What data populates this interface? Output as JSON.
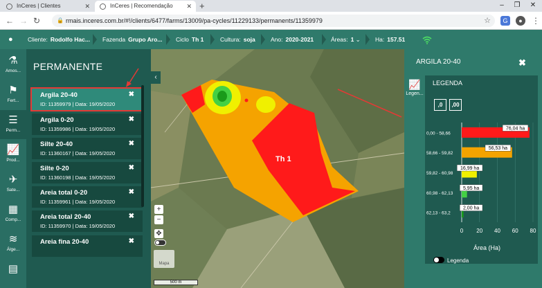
{
  "browser": {
    "tabs": [
      {
        "title": "InCeres | Clientes"
      },
      {
        "title": "InCeres | Recomendação"
      }
    ],
    "url": "rmais.inceres.com.br/#!/clients/6477/farms/13009/pa-cycles/11229133/permanents/11359979"
  },
  "header": {
    "client_label": "Cliente:",
    "client_value": "Rodolfo Hac...",
    "farm_label": "Fazenda",
    "farm_value": "Grupo Aro...",
    "cycle_label": "Ciclo",
    "cycle_value": "Th 1",
    "crop_label": "Cultura:",
    "crop_value": "soja",
    "year_label": "Ano:",
    "year_value": "2020-2021",
    "areas_label": "Áreas:",
    "areas_value": "1",
    "ha_label": "Ha:",
    "ha_value": "157.51"
  },
  "rail": [
    {
      "label": "Amos..."
    },
    {
      "label": "Fert..."
    },
    {
      "label": "Perm..."
    },
    {
      "label": "Prod..."
    },
    {
      "label": "Sate..."
    },
    {
      "label": "Comp..."
    },
    {
      "label": "Álge..."
    },
    {
      "label": ""
    }
  ],
  "panel": {
    "title": "PERMANENTE",
    "layers": [
      {
        "name": "Argila 20-40",
        "meta": "ID: 11359979 | Data: 19/05/2020"
      },
      {
        "name": "Argila 0-20",
        "meta": "ID: 11359986 | Data: 19/05/2020"
      },
      {
        "name": "Silte 20-40",
        "meta": "ID: 11360167 | Data: 19/05/2020"
      },
      {
        "name": "Silte 0-20",
        "meta": "ID: 11360198 | Data: 19/05/2020"
      },
      {
        "name": "Areia total 0-20",
        "meta": "ID: 11359961 | Data: 19/05/2020"
      },
      {
        "name": "Areia total 20-40",
        "meta": "ID: 11359970 | Data: 19/05/2020"
      },
      {
        "name": "Areia fina 20-40",
        "meta": ""
      }
    ]
  },
  "map": {
    "field_label": "Th 1",
    "scale_label": "500 m",
    "minimap_label": "Mapa"
  },
  "legend": {
    "title": "ARGILA 20-40",
    "tab_label": "Legen...",
    "heading": "LEGENDA",
    "format_buttons": [
      ",0",
      ",00"
    ],
    "toggle_label": "Legenda",
    "colors": {
      "red": "#ff1a1a",
      "orange": "#f5a300",
      "yellow": "#f0f000",
      "lightgreen": "#44d044",
      "green": "#1a9a1a"
    }
  },
  "chart_data": {
    "type": "bar",
    "orientation": "horizontal",
    "categories": [
      "0,00 - 58,66",
      "58,66 - 59,82",
      "59,82 - 60,98",
      "60,98 - 62,13",
      "62,13 - 63,2"
    ],
    "values": [
      76.04,
      56.53,
      16.99,
      5.95,
      2.0
    ],
    "data_labels": [
      "76,04 ha",
      "56,53 ha",
      "16,99 ha",
      "5,95 ha",
      "2,00 ha"
    ],
    "bar_colors": [
      "#ff1a1a",
      "#f5a300",
      "#f0f000",
      "#44d044",
      "#1a9a1a"
    ],
    "xlabel": "Área (Ha)",
    "xlim": [
      0,
      80
    ],
    "xticks": [
      "0",
      "20",
      "40",
      "60",
      "80"
    ],
    "grid": true
  }
}
